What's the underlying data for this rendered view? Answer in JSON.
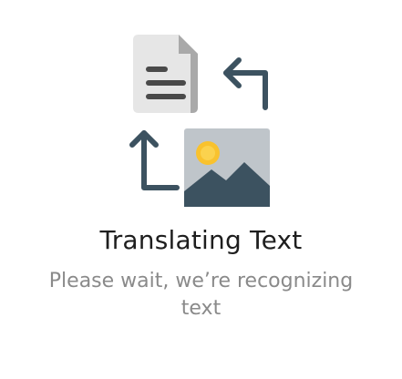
{
  "status": {
    "title": "Translating Text",
    "message": "Please wait, we’re recognizing text"
  },
  "icons": {
    "document": "document-icon",
    "arrow_up_left": "arrow-return-icon",
    "arrow_up": "arrow-up-icon",
    "image": "image-icon"
  },
  "colors": {
    "document_paper": "#e6e6e6",
    "document_fold": "#a9a9a9",
    "text_lines": "#4a4a4a",
    "arrow": "#3c5260",
    "image_bg": "#bfc5ca",
    "mountain": "#3c5260",
    "sun": "#f9c22e",
    "title_text": "#1e1e1e",
    "subtitle_text": "#8a8a8a"
  }
}
